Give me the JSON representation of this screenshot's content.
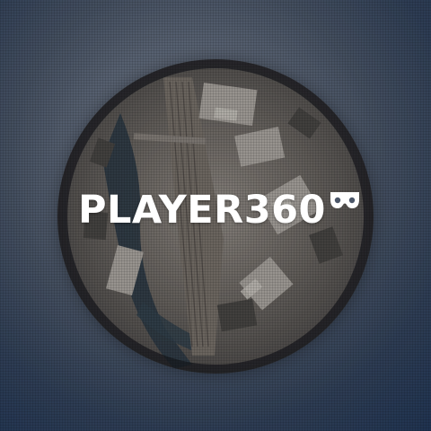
{
  "logo": {
    "text": "PLAYER360",
    "icon": "vr-headset-icon",
    "color": "#ffffff"
  },
  "scene": {
    "image": "little-planet-aerial-city-panorama"
  }
}
